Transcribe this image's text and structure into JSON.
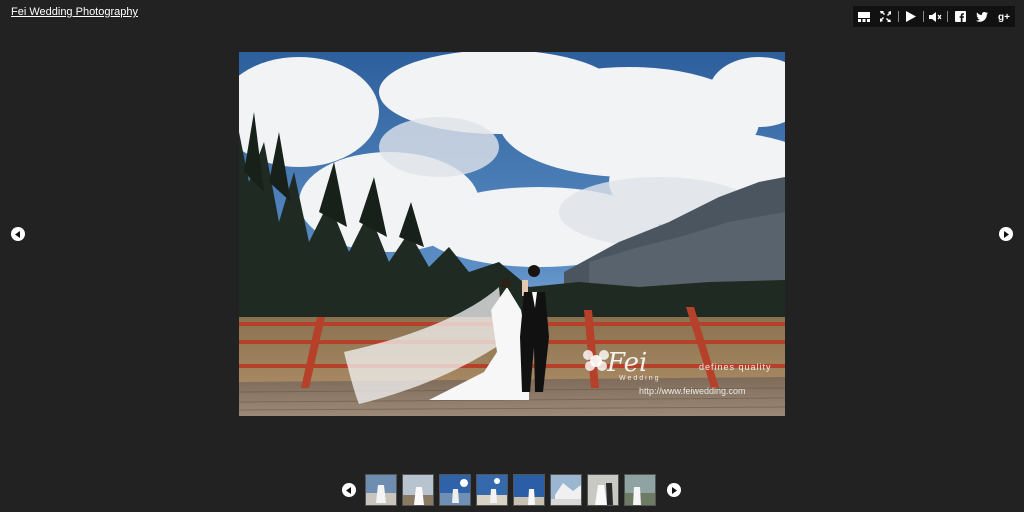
{
  "site": {
    "title": "Fei Wedding Photography"
  },
  "toolbar": {
    "items": [
      {
        "icon": "thumbnails-icon"
      },
      {
        "icon": "fullscreen-icon"
      },
      {
        "icon": "play-icon"
      },
      {
        "icon": "mute-icon"
      },
      {
        "icon": "facebook-icon"
      },
      {
        "icon": "twitter-icon"
      },
      {
        "icon": "google-plus-icon"
      }
    ]
  },
  "photo": {
    "watermark_brand": "Fei",
    "watermark_sub": "Wedding",
    "watermark_tagline": "defines quality",
    "watermark_url": "http://www.feiwedding.com"
  },
  "navigation": {
    "prev_icon": "chevron-left-icon",
    "next_icon": "chevron-right-icon"
  },
  "thumbnails": {
    "count_visible": 8
  },
  "colors": {
    "background": "#222222",
    "toolbar": "#111111",
    "sky": "#3f78b8",
    "fence": "#b5412b"
  }
}
